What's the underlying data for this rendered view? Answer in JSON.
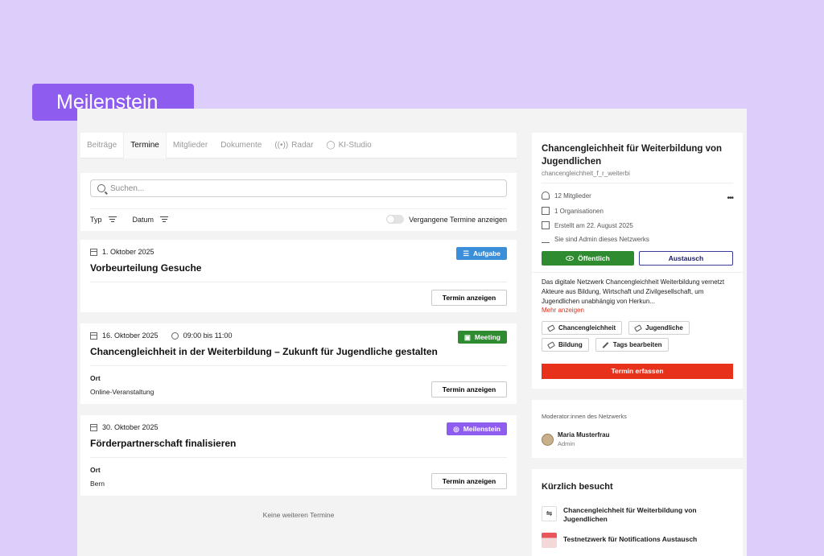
{
  "hero_badge": "Meilenstein",
  "tabs": [
    {
      "label": "Beiträge",
      "icon": ""
    },
    {
      "label": "Termine",
      "icon": ""
    },
    {
      "label": "Mitglieder",
      "icon": ""
    },
    {
      "label": "Dokumente",
      "icon": ""
    },
    {
      "label": "Radar",
      "icon": "radar-icon"
    },
    {
      "label": "KI-Studio",
      "icon": "ai-studio-icon"
    }
  ],
  "filters": {
    "search_placeholder": "Suchen...",
    "type_label": "Typ",
    "date_label": "Datum",
    "toggle_label": "Vergangene Termine anzeigen"
  },
  "events": [
    {
      "date": "1. Oktober 2025",
      "time": "",
      "title": "Vorbeurteilung Gesuche",
      "badge": "Aufgabe",
      "badge_color": "#3b8fd9",
      "ort_label": "",
      "ort_value": "",
      "button": "Termin anzeigen"
    },
    {
      "date": "16. Oktober 2025",
      "time": "09:00 bis 11:00",
      "title": "Chancengleichheit in der Weiterbildung – Zukunft für Jugendliche gestalten",
      "badge": "Meeting",
      "badge_color": "#2e8b30",
      "ort_label": "Ort",
      "ort_value": "Online-Veranstaltung",
      "button": "Termin anzeigen"
    },
    {
      "date": "30. Oktober 2025",
      "time": "",
      "title": "Förderpartnerschaft finalisieren",
      "badge": "Meilenstein",
      "badge_color": "#8f5cf0",
      "ort_label": "Ort",
      "ort_value": "Bern",
      "button": "Termin anzeigen"
    }
  ],
  "no_more": "Keine weiteren Termine",
  "network": {
    "title": "Chancengleichheit für Weiterbildung von Jugendlichen",
    "slug": "chancengleichheit_f_r_weiterbi",
    "members": "12 Mitglieder",
    "organisations": "1 Organisationen",
    "created": "Erstellt am 22. August 2025",
    "admin_note": "Sie sind Admin dieses Netzwerks",
    "public_button": "Öffentlich",
    "exchange_button": "Austausch",
    "description": "Das digitale Netzwerk Chancengleichheit Weiterbildung vernetzt Akteure aus Bildung, Wirtschaft und Zivilgesellschaft, um Jugendlichen unabhängig von Herkun...",
    "more_link": "Mehr anzeigen",
    "tags": [
      "Chancengleichheit",
      "Jugendliche",
      "Bildung"
    ],
    "edit_tags": "Tags bearbeiten",
    "cta": "Termin erfassen"
  },
  "moderators": {
    "title": "Moderator:innen des Netzwerks",
    "name": "Maria Musterfrau",
    "role": "Admin"
  },
  "recent": {
    "title": "Kürzlich besucht",
    "items": [
      {
        "label": "Chancengleichheit für Weiterbildung von Jugendlichen"
      },
      {
        "label": "Testnetzwerk für Notifications Austausch"
      }
    ]
  },
  "colors": {
    "background": "#dccdfa",
    "accent_purple": "#8f5cf0",
    "public_green": "#2e8b30",
    "cta_red": "#e8311a"
  }
}
